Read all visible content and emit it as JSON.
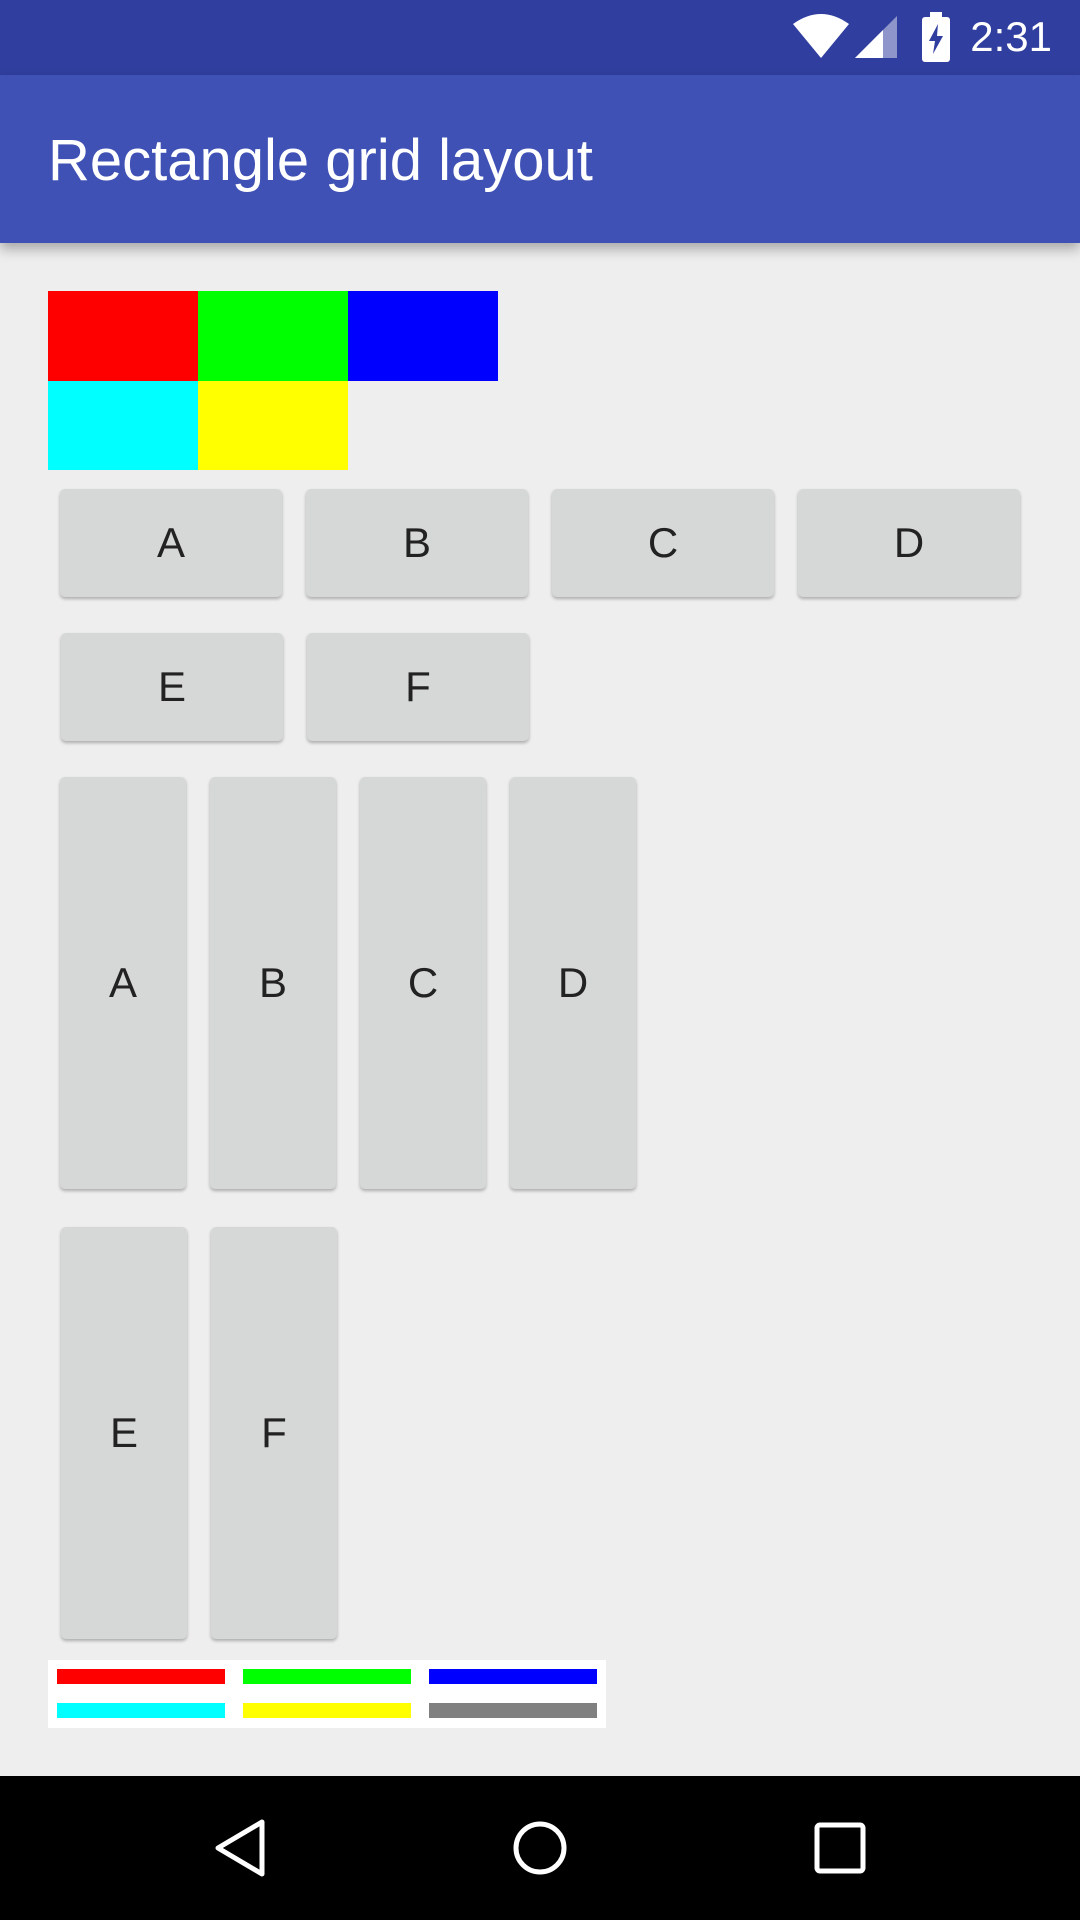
{
  "status_bar": {
    "time": "2:31",
    "icons": [
      "wifi-icon",
      "cell-signal-icon",
      "battery-charging-icon"
    ]
  },
  "app_bar": {
    "title": "Rectangle grid layout"
  },
  "color_grid": {
    "cells": [
      {
        "name": "red",
        "color": "#ff0000"
      },
      {
        "name": "green",
        "color": "#00ff00"
      },
      {
        "name": "blue",
        "color": "#0000ff"
      },
      {
        "name": "cyan",
        "color": "#00ffff"
      },
      {
        "name": "yellow",
        "color": "#ffff00"
      }
    ]
  },
  "wide_buttons": [
    "A",
    "B",
    "C",
    "D",
    "E",
    "F"
  ],
  "tall_buttons": [
    "A",
    "B",
    "C",
    "D",
    "E",
    "F"
  ],
  "legend": {
    "bars": [
      {
        "name": "red",
        "color": "#ff0000"
      },
      {
        "name": "green",
        "color": "#00ff00"
      },
      {
        "name": "blue",
        "color": "#0000ff"
      },
      {
        "name": "cyan",
        "color": "#00ffff"
      },
      {
        "name": "yellow",
        "color": "#ffff00"
      },
      {
        "name": "gray",
        "color": "#808080"
      }
    ]
  },
  "nav_bar": {
    "icons": [
      "back-icon",
      "home-icon",
      "recents-icon"
    ]
  }
}
